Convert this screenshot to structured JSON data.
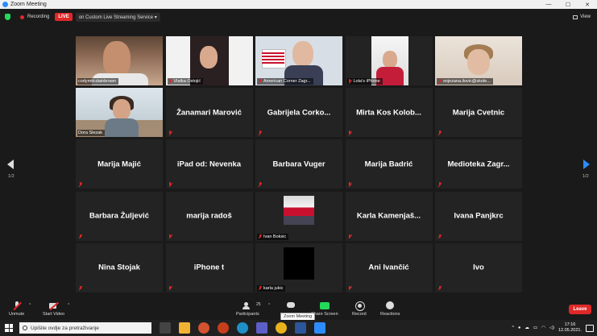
{
  "window": {
    "title": "Zoom Meeting",
    "minimize": "—",
    "maximize": "☐",
    "close": "✕"
  },
  "topbar": {
    "recording_label": "Recording",
    "live_label": "LIVE",
    "stream_label": "on Custom Live Streaming Service",
    "stream_caret": "▾",
    "view_label": "View"
  },
  "tiles": [
    {
      "name": "codymitcdainbrown",
      "video": true
    },
    {
      "name": "Vlatka Ostojić",
      "video": true
    },
    {
      "name": "American Corner Zagr...",
      "video": true
    },
    {
      "name": "Lota's iPhone",
      "video": true
    },
    {
      "name": "snjezana.ilovic@skole...",
      "video": true
    },
    {
      "name": "Dora Slezak",
      "video": true
    },
    {
      "name": "Žanamari Marović"
    },
    {
      "name": "Gabrijela Corko..."
    },
    {
      "name": "Mirta Kos Kolob..."
    },
    {
      "name": "Marija Cvetnic"
    },
    {
      "name": "Marija Majić"
    },
    {
      "name": "iPad od: Nevenka"
    },
    {
      "name": "Barbara Vuger"
    },
    {
      "name": "Marija Badrić"
    },
    {
      "name": "Medioteka Zagr..."
    },
    {
      "name": "Barbara Žuljević"
    },
    {
      "name": "marija radoš"
    },
    {
      "name": "Ivan Boksic",
      "thumb": true
    },
    {
      "name": "Karla Kamenjaš..."
    },
    {
      "name": "Ivana Panjkrc"
    },
    {
      "name": "Nina Stojak"
    },
    {
      "name": "iPhone t"
    },
    {
      "name": "karla jukic",
      "black": true
    },
    {
      "name": "Ani Ivančić"
    },
    {
      "name": "Ivo"
    }
  ],
  "pagination": {
    "left": "1/2",
    "right": "1/2"
  },
  "toolbar": {
    "unmute": "Unmute",
    "start_video": "Start Video",
    "participants": "Participants",
    "participants_count": "25",
    "chat_tooltip": "Zoom Meeting",
    "share_screen": "Share Screen",
    "record": "Record",
    "reactions": "Reactions",
    "leave": "Leave"
  },
  "taskbar": {
    "search_placeholder": "Upišite ovdje za pretraživanje",
    "time": "17:16",
    "date": "12.05.2021."
  },
  "colors": {
    "accent": "#2d8cff",
    "live": "#e02828",
    "active_speaker": "#e4e628",
    "share": "#23d959"
  }
}
